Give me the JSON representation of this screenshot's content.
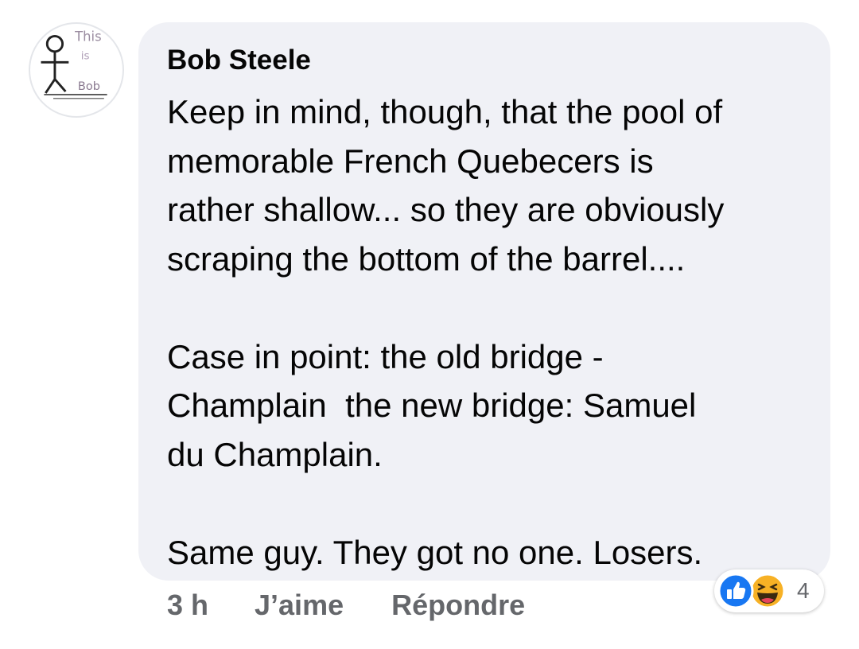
{
  "avatar": {
    "alt": "This is Bob",
    "lettering": [
      "This",
      "is",
      "Bob"
    ]
  },
  "comment": {
    "author": "Bob Steele",
    "paragraphs": [
      [
        "Keep in mind, though, that the pool of",
        "memorable French Quebecers is",
        "rather shallow... so they are obviously",
        "scraping the bottom of the barrel...."
      ],
      [
        "Case in point: the old bridge -",
        "Champlain  the new bridge: Samuel",
        "du Champlain."
      ],
      [
        "Same guy. They got no one. Losers."
      ]
    ]
  },
  "actions": {
    "time": "3 h",
    "like": "J’aime",
    "reply": "Répondre"
  },
  "reactions": {
    "types": [
      "like-icon",
      "haha-icon"
    ],
    "count": "4",
    "colors": {
      "like": "#1877f2",
      "haha": "#f7b125"
    }
  }
}
